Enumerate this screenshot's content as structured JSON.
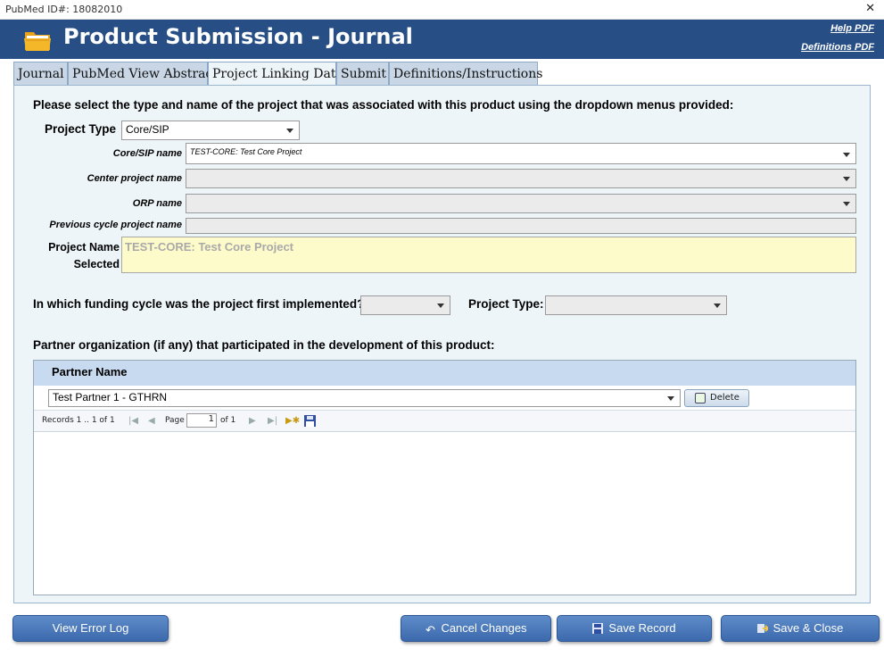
{
  "window": {
    "caption": "PubMed ID#: 18082010",
    "close_glyph": "✕"
  },
  "header": {
    "title": "Product Submission - Journal",
    "help_link": "Help PDF",
    "definitions_link": "Definitions PDF",
    "icon": "folder-icon",
    "bg_color": "#274f86"
  },
  "tabs": [
    {
      "label": "Journal"
    },
    {
      "label": "PubMed View Abstract"
    },
    {
      "label": "Project Linking Data",
      "active": true
    },
    {
      "label": "Submit"
    },
    {
      "label": "Definitions/Instructions"
    }
  ],
  "form": {
    "instruction": "Please select the type and name of the project that was associated with this product using the dropdown menus provided:",
    "project_type_label": "Project Type",
    "project_type_value": "Core/SIP",
    "core_sip_label": "Core/SIP name",
    "core_sip_value": "TEST-CORE: Test Core Project",
    "center_project_label": "Center project name",
    "orp_label": "ORP name",
    "previous_cycle_label": "Previous cycle project name",
    "project_name_selected_label_1": "Project Name",
    "project_name_selected_label_2": "Selected",
    "project_name_selected_value": "TEST-CORE: Test Core Project",
    "funding_cycle_label": "In which funding cycle was the project first implemented?",
    "project_type2_label": "Project Type:",
    "partner_heading": "Partner organization (if any) that participated in the development of this product:"
  },
  "grid": {
    "column": "Partner Name",
    "rows": [
      {
        "partner": "Test Partner 1 - GTHRN",
        "delete_label": "Delete"
      }
    ],
    "pager": {
      "records": "Records 1 .. 1 of 1",
      "page_label": "Page",
      "page_value": "1",
      "of_label": "of 1"
    }
  },
  "buttons": {
    "view_error_log": "View Error Log",
    "cancel_changes": "Cancel Changes",
    "save_record": "Save Record",
    "save_close": "Save & Close"
  }
}
